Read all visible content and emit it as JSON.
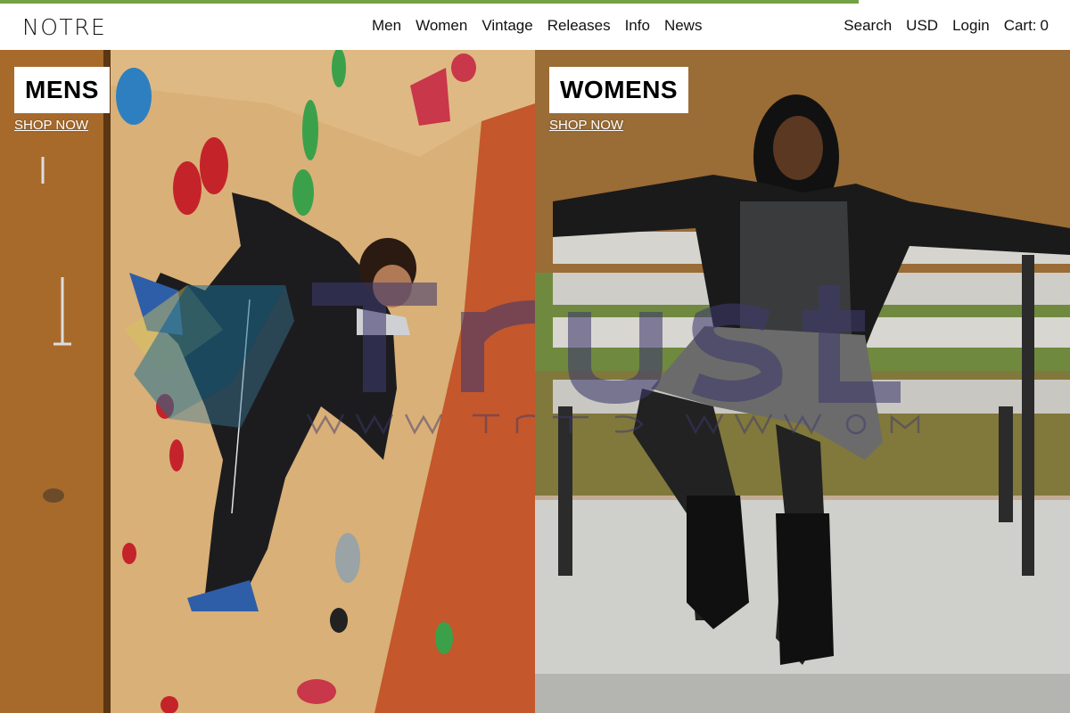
{
  "colors": {
    "accent_bar": "#74a046",
    "text": "#111111",
    "label_bg": "#ffffff"
  },
  "progress": {
    "fraction": 0.8025
  },
  "header": {
    "logo": "NOTRE",
    "nav": [
      "Men",
      "Women",
      "Vintage",
      "Releases",
      "Info",
      "News"
    ],
    "utility": {
      "search": "Search",
      "currency": "USD",
      "login": "Login",
      "cart_label": "Cart:",
      "cart_count": "0"
    }
  },
  "panels": {
    "mens": {
      "title": "MENS",
      "cta": "SHOP NOW",
      "image": "man-climbing-wall-photo"
    },
    "womens": {
      "title": "WOMENS",
      "cta": "SHOP NOW",
      "image": "woman-on-park-bench-photo"
    }
  },
  "watermark": {
    "icon": "trust-logo-icon"
  }
}
